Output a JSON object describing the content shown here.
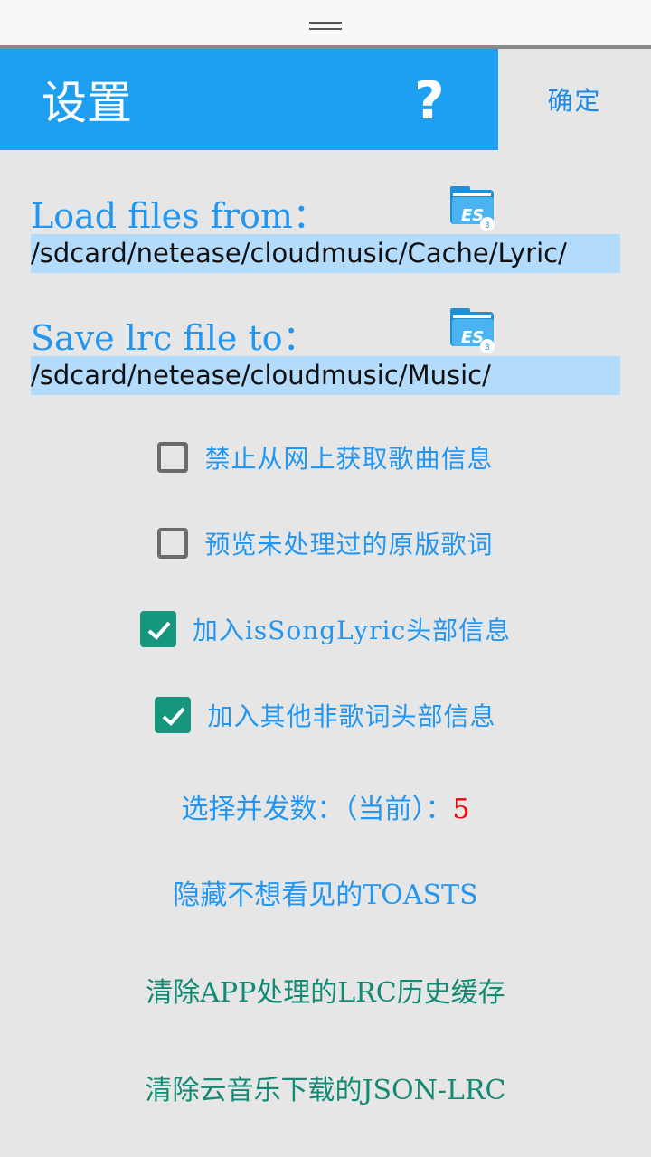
{
  "header": {
    "title": "设置",
    "help_glyph": "?",
    "ok_label": "确定"
  },
  "load": {
    "label": "Load files from：",
    "path": "/sdcard/netease/cloudmusic/Cache/Lyric/",
    "icon": "es-file-explorer-icon"
  },
  "save": {
    "label": "Save lrc file to：",
    "path": "/sdcard/netease/cloudmusic/Music/",
    "icon": "es-file-explorer-icon"
  },
  "options": [
    {
      "label": "禁止从网上获取歌曲信息",
      "checked": false
    },
    {
      "label": "预览未处理过的原版歌词",
      "checked": false
    },
    {
      "label": "加入isSongLyric头部信息",
      "checked": true
    },
    {
      "label": "加入其他非歌词头部信息",
      "checked": true
    }
  ],
  "concurrency": {
    "label": "选择并发数：（当前）：",
    "value": "5"
  },
  "hide_toasts": "隐藏不想看见的TOASTS",
  "clear_lrc_cache": "清除APP处理的LRC历史缓存",
  "clear_json_lrc": "清除云音乐下载的JSON-LRC",
  "colors": {
    "accent": "#1e9ff2",
    "checkbox": "#15967d",
    "path_bg": "#b3dcfc",
    "value": "#ff0000",
    "teal_text": "#138a74"
  }
}
